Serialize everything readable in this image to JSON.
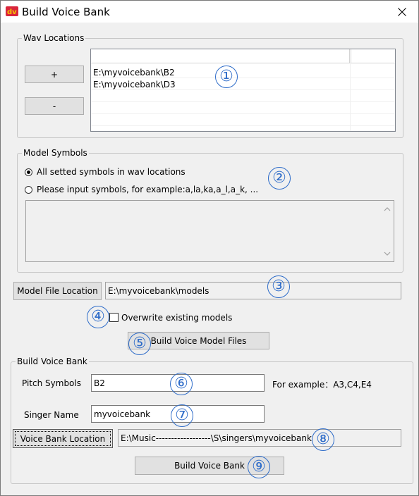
{
  "window": {
    "title": "Build Voice Bank",
    "icon": "dv-app-icon",
    "close_icon": "close-icon"
  },
  "wav_locations": {
    "group_label": "Wav Locations",
    "add_label": "+",
    "remove_label": "-",
    "rows": [
      "E:\\myvoicebank\\B2",
      "E:\\myvoicebank\\D3"
    ]
  },
  "model_symbols": {
    "group_label": "Model Symbols",
    "option_all": "All setted symbols in wav locations",
    "option_input": "Please input symbols, for example:a,la,ka,a_l,a_k, ...",
    "selected": "all",
    "input_value": ""
  },
  "model_file": {
    "button_label": "Model File Location",
    "path": "E:\\myvoicebank\\models",
    "overwrite_label": "Overwrite existing models",
    "overwrite_checked": false,
    "build_label": "Build Voice Model Files"
  },
  "build_bank": {
    "group_label": "Build Voice Bank",
    "pitch_label": "Pitch Symbols",
    "pitch_value": "B2",
    "pitch_example": "For example：A3,C4,E4",
    "singer_label": "Singer Name",
    "singer_value": "myvoicebank",
    "location_button": "Voice Bank Location",
    "location_path": "E:\\Music------------------\\S\\singers\\myvoicebank",
    "build_label": "Build Voice Bank"
  },
  "markers": [
    "①",
    "②",
    "③",
    "④",
    "⑤",
    "⑥",
    "⑦",
    "⑧",
    "⑨"
  ],
  "colors": {
    "marker": "#2e6cc9",
    "icon_red": "#d9263a",
    "icon_yellow": "#f5c400"
  }
}
